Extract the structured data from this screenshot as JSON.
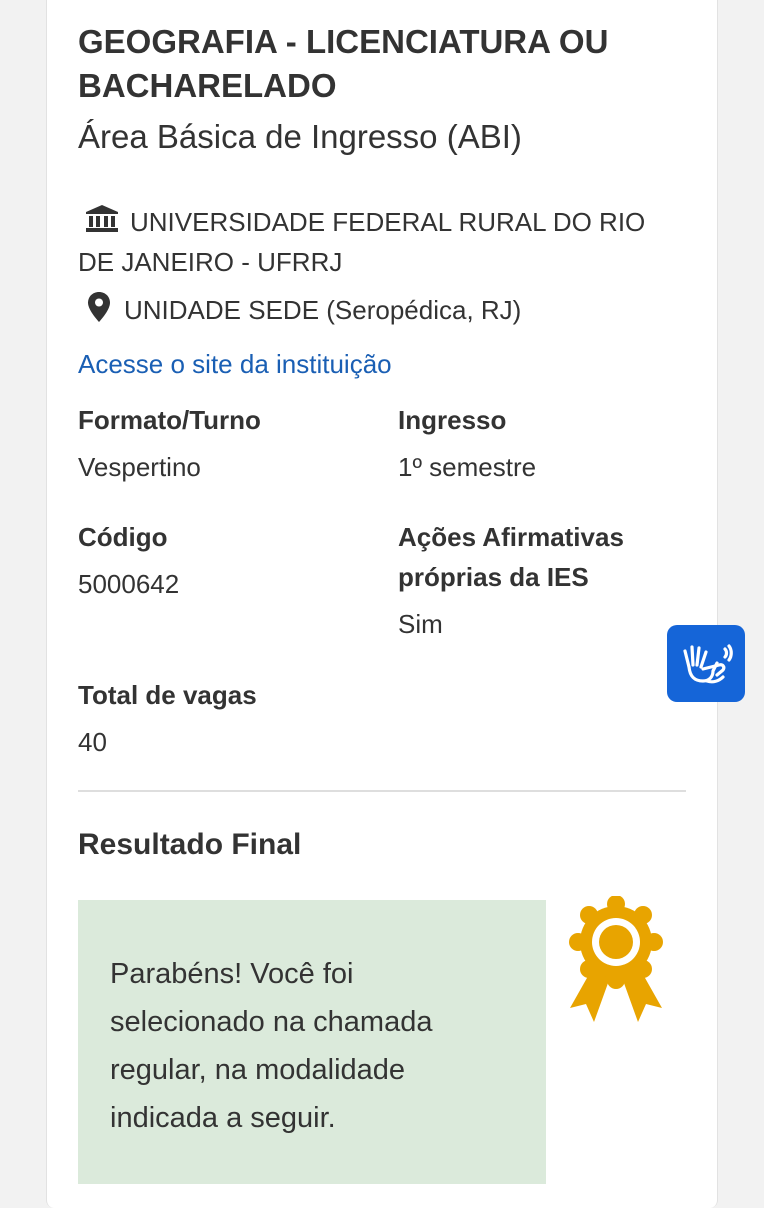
{
  "course": {
    "title": "GEOGRAFIA - LICENCIATURA OU BACHARELADO",
    "subtitle": "Área Básica de Ingresso (ABI)"
  },
  "institution": {
    "icon": "institution-building-icon",
    "name": "UNIVERSIDADE FEDERAL RURAL DO RIO DE JANEIRO - UFRRJ",
    "location_icon": "location-pin-icon",
    "location": "UNIDADE SEDE (Seropédica, RJ)",
    "site_link": "Acesse o site da instituição"
  },
  "details": {
    "formato_label": "Formato/Turno",
    "formato_value": "Vespertino",
    "ingresso_label": "Ingresso",
    "ingresso_value": "1º semestre",
    "codigo_label": "Código",
    "codigo_value": "5000642",
    "acoes_label": "Ações Afirmativas próprias da IES",
    "acoes_value": "Sim",
    "vagas_label": "Total de vagas",
    "vagas_value": "40"
  },
  "result": {
    "title": "Resultado Final",
    "message": "Parabéns! Você foi selecionado na chamada regular, na modalidade indicada a seguir.",
    "icon": "award-ribbon-icon"
  },
  "accessibility": {
    "icon": "sign-language-hands-icon"
  },
  "colors": {
    "link": "#1a5fb4",
    "result_bg": "#dbeadb",
    "award": "#e8a400",
    "accessibility_button": "#1565d8"
  }
}
